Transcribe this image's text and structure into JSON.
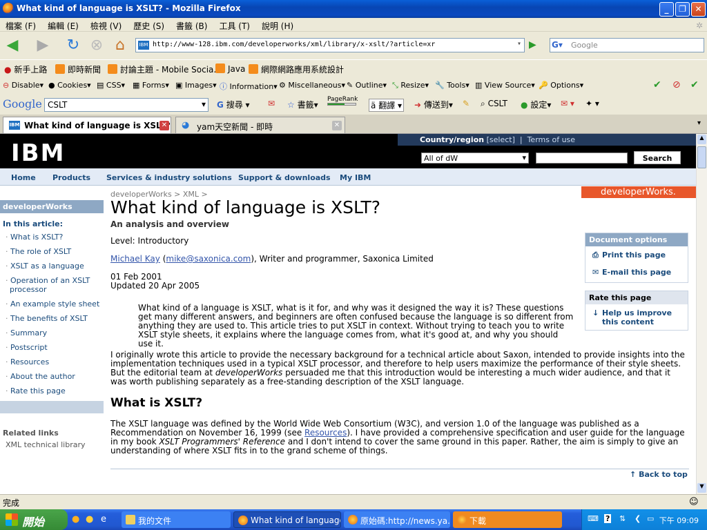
{
  "window": {
    "title": "What kind of language is XSLT? - Mozilla Firefox"
  },
  "menu": [
    "檔案 (F)",
    "編輯 (E)",
    "檢視 (V)",
    "歷史 (S)",
    "書籤 (B)",
    "工具 (T)",
    "說明 (H)"
  ],
  "nav": {
    "url": "http://www-128.ibm.com/developerworks/xml/library/x-xslt/?article=xr",
    "search_placeholder": "Google",
    "site_icon": "IBM"
  },
  "bookmarks": [
    "新手上路",
    "即時新聞",
    "討論主題 - Mobile Socia...",
    "Java",
    "網際網路應用系統設計"
  ],
  "webdev": [
    "Disable▾",
    "Cookies▾",
    "CSS▾",
    "Forms▾",
    "Images▾",
    "Information▾",
    "Miscellaneous▾",
    "Outline▾",
    "Resize▾",
    "Tools▾",
    "View Source▾",
    "Options▾"
  ],
  "gtoolbar": {
    "logo": "Google",
    "query": "CSLT",
    "search": "搜尋",
    "bookmarks": "書籤▾",
    "pagerank": "PageRank",
    "translate": "翻譯",
    "sendto": "傳送到▾",
    "cslt": "CSLT",
    "settings": "設定▾"
  },
  "tabs": [
    {
      "label": "What kind of language is XSLT?",
      "icon": "IBM"
    },
    {
      "label": "yam天空新聞 - 即時"
    }
  ],
  "ibm": {
    "logo": "IBM",
    "country": "Country/region",
    "select": "[select]",
    "terms": "Terms of use",
    "scope": "All of dW",
    "search_btn": "Search",
    "topnav": [
      "Home",
      "Products",
      "Services & industry solutions",
      "Support & downloads",
      "My IBM"
    ],
    "dw_badge": "developerWorks."
  },
  "leftnav": {
    "header": "developerWorks",
    "in_article": "In this article:",
    "items": [
      "What is XSLT?",
      "The role of XSLT",
      "XSLT as a language",
      "Operation of an XSLT processor",
      "An example style sheet",
      "The benefits of XSLT",
      "Summary",
      "Postscript",
      "Resources",
      "About the author",
      "Rate this page"
    ],
    "related_header": "Related links",
    "related": [
      "XML technical library"
    ]
  },
  "article": {
    "crumb": "developerWorks  >  XML  >",
    "title": "What kind of language is XSLT?",
    "subtitle": "An analysis and overview",
    "level": "Level: Introductory",
    "author": "Michael Kay",
    "author_email": "mike@saxonica.com",
    "author_role": "), Writer and programmer, Saxonica Limited",
    "date1": "01 Feb 2001",
    "date2": "Updated 20 Apr 2005",
    "abstract": "What kind of a language is XSLT, what is it for, and why was it designed the way it is? These questions get many different answers, and beginners are often confused because the language is so different from anything they are used to. This article tries to put XSLT in context. Without trying to teach you to write XSLT style sheets, it explains where the language comes from, what it's good at, and why you should use it.",
    "para1_a": "I originally wrote this article to provide the necessary background for a technical article about Saxon, intended to provide insights into the implementation techniques used in a typical XSLT processor, and therefore to help users maximize the performance of their style sheets. But the editorial team at ",
    "para1_em": "developerWorks",
    "para1_b": " persuaded me that this introduction would be interesting a much wider audience, and that it was worth publishing separately as a free-standing description of the XSLT language.",
    "h2": "What is XSLT?",
    "para2_a": "The XSLT language was defined by the World Wide Web Consortium (W3C), and version 1.0 of the language was published as a Recommendation on November 16, 1999 (see ",
    "para2_link": "Resources",
    "para2_b": "). I have provided a comprehensive specification and user guide for the language in my book ",
    "para2_em": "XSLT Programmers' Reference",
    "para2_c": " and I don't intend to cover the same ground in this paper. Rather, the aim is simply to give an understanding of where XSLT fits in to the grand scheme of things.",
    "back_to_top": "Back to top"
  },
  "docoptions": {
    "header": "Document options",
    "print": "Print this page",
    "email": "E-mail this page"
  },
  "rate": {
    "header": "Rate this page",
    "help": "Help us improve this content"
  },
  "status": "完成",
  "taskbar": {
    "start": "開始",
    "tasks": [
      "我的文件",
      "What kind of language...",
      "原始碼:http://news.ya...",
      "下載"
    ],
    "clock": "下午 09:09"
  }
}
